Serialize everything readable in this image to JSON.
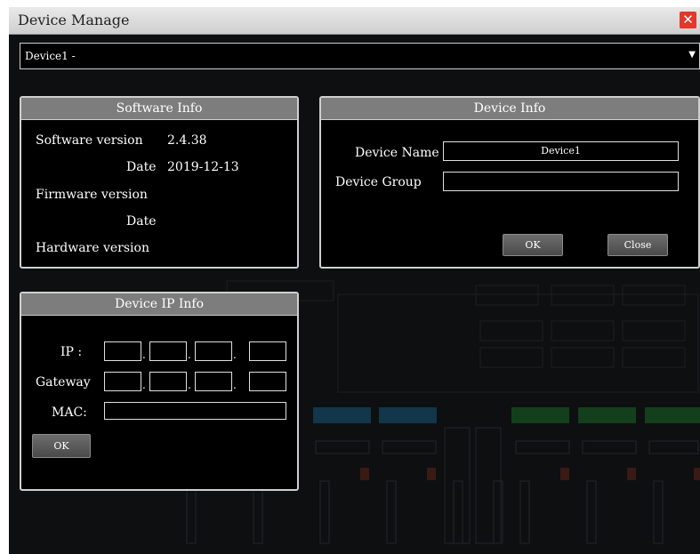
{
  "window": {
    "title": "Device Manage"
  },
  "device_selector": {
    "value": "Device1 -"
  },
  "software_info": {
    "header": "Software Info",
    "rows": [
      {
        "label": "Software version",
        "value": "2.4.38"
      },
      {
        "label": "Date",
        "value": "2019-12-13"
      },
      {
        "label": "Firmware version",
        "value": ""
      },
      {
        "label": "Date",
        "value": ""
      },
      {
        "label": "Hardware version",
        "value": ""
      }
    ]
  },
  "device_info": {
    "header": "Device Info",
    "name_label": "Device Name",
    "name_value": "Device1",
    "group_label": "Device Group",
    "group_value": "",
    "ok_label": "OK",
    "close_label": "Close"
  },
  "ip_info": {
    "header": "Device IP Info",
    "ip_label": "IP :",
    "gateway_label": "Gateway",
    "mac_label": "MAC:",
    "mac_value": "",
    "ok_label": "OK",
    "dot": "."
  },
  "colors": {
    "close_button": "#e2372b",
    "panel_header": "#7d7d7d",
    "background": "#0e0f10",
    "channel_green": "#1e6b2a",
    "channel_blue": "#1e4d6b"
  }
}
